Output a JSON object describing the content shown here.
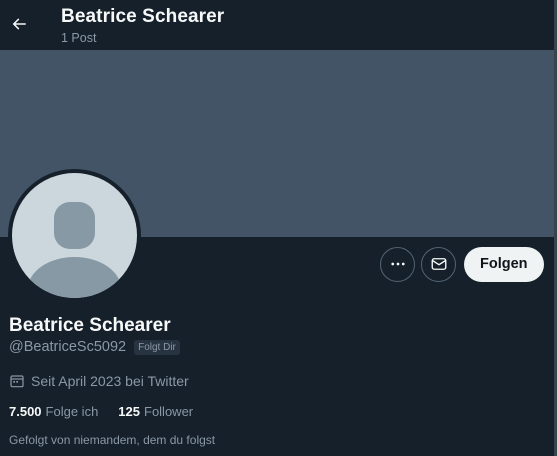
{
  "header": {
    "title": "Beatrice Schearer",
    "post_count": "1 Post",
    "back_icon": "arrow-left-icon"
  },
  "colors": {
    "background": "#15202b",
    "banner": "#425466",
    "avatar": "#ccd6dd",
    "avatar_silhouette": "#8899a6",
    "muted_text": "#8b98a5",
    "follow_button": "#eff3f4"
  },
  "actions": {
    "more_icon": "more-horizontal-icon",
    "message_icon": "envelope-icon",
    "follow_label": "Folgen"
  },
  "profile": {
    "name": "Beatrice Schearer",
    "handle": "@BeatriceSc5092",
    "follows_you_badge": "Folgt Dir",
    "joined_icon": "calendar-icon",
    "joined": "Seit April 2023 bei Twitter",
    "following_count": "7.500",
    "following_label": "Folge ich",
    "followers_count": "125",
    "followers_label": "Follower",
    "followed_by": "Gefolgt von niemandem, dem du folgst"
  }
}
